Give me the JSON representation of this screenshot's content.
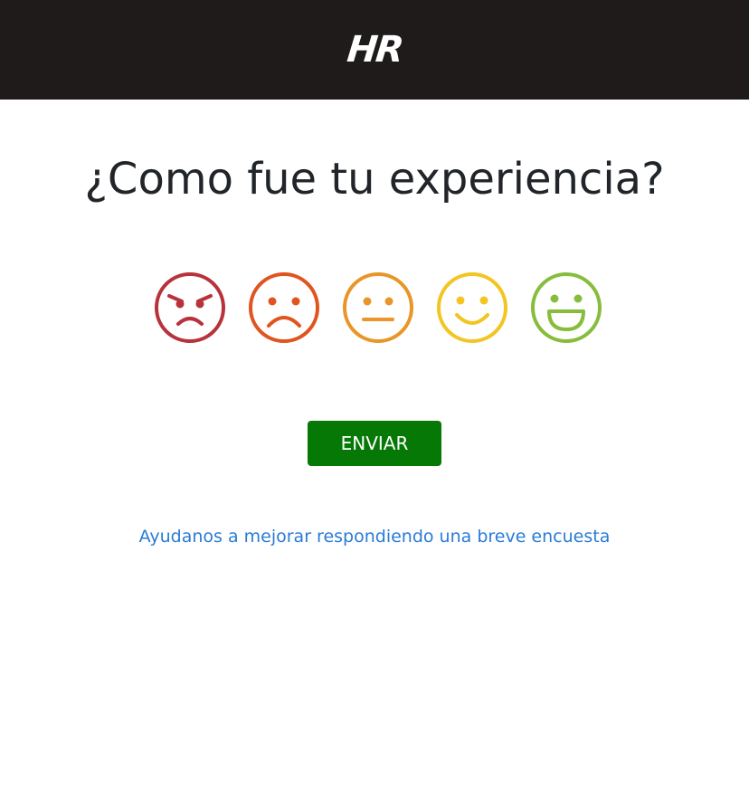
{
  "header": {
    "logo_text": "HR",
    "background": "#1f1b1a"
  },
  "main": {
    "title": "¿Como fue tu experiencia?",
    "ratings": [
      {
        "name": "angry",
        "color": "#b8323b"
      },
      {
        "name": "sad",
        "color": "#e0541f"
      },
      {
        "name": "neutral",
        "color": "#e8962a"
      },
      {
        "name": "smile",
        "color": "#f2c522"
      },
      {
        "name": "laugh",
        "color": "#86bd3c"
      }
    ],
    "submit_label": "ENVIAR",
    "submit_color": "#067806",
    "survey_link_text": "Ayudanos a mejorar respondiendo una breve encuesta",
    "link_color": "#2a7bd6"
  }
}
